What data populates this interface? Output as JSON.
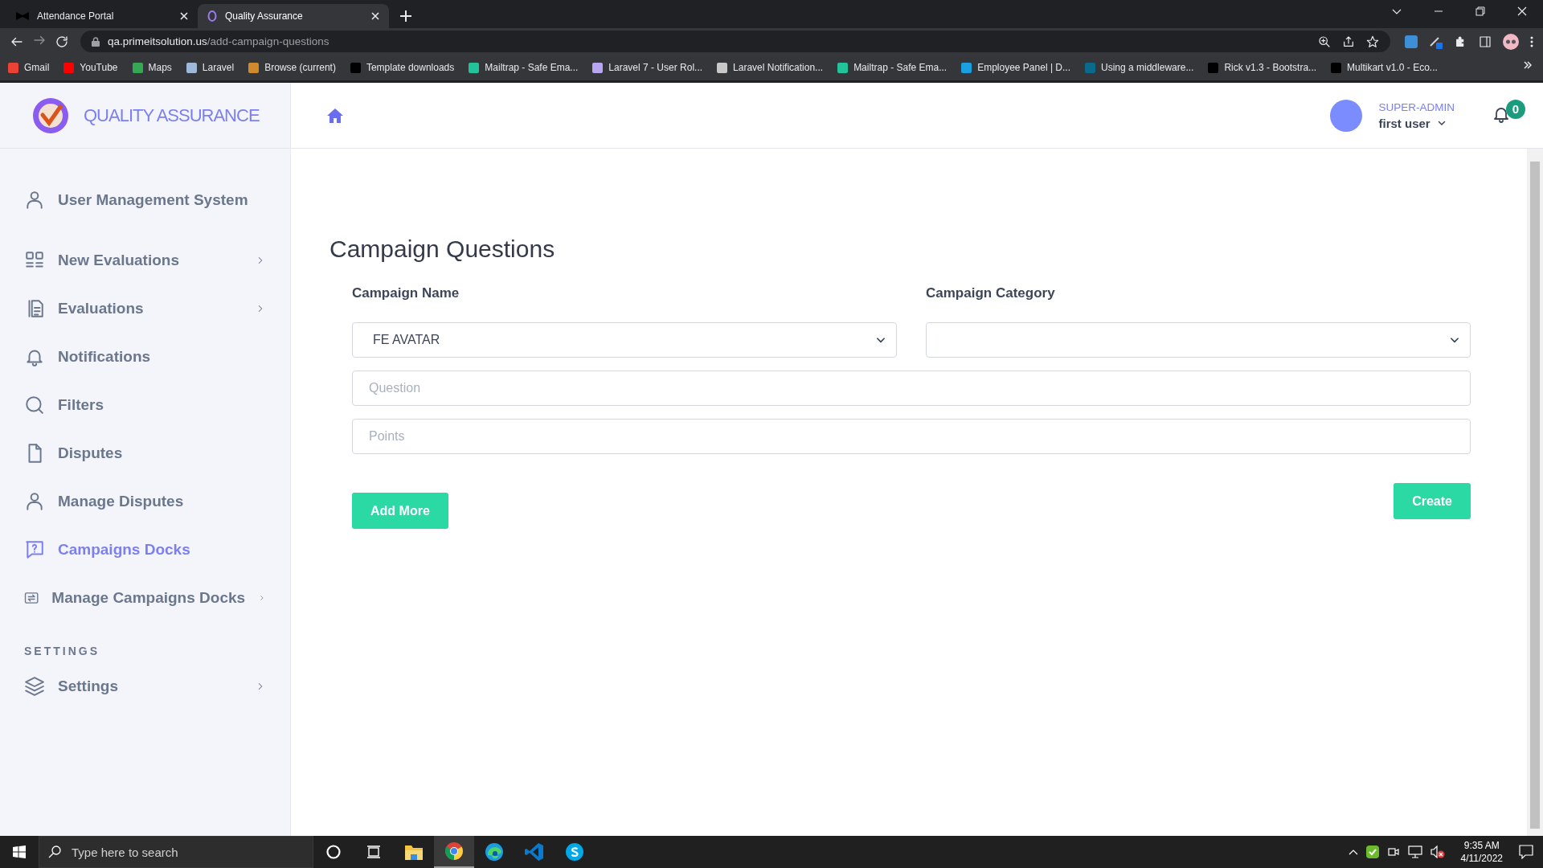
{
  "browser": {
    "tabs": [
      {
        "title": "Attendance Portal",
        "selected": false
      },
      {
        "title": "Quality Assurance",
        "selected": true
      }
    ],
    "address": {
      "host": "qa.primeitsolution.us",
      "path": "/add-campaign-questions"
    },
    "bookmarks": [
      {
        "label": "Gmail",
        "color": "#ea4335"
      },
      {
        "label": "YouTube",
        "color": "#ff0000"
      },
      {
        "label": "Maps",
        "color": "#34a853"
      },
      {
        "label": "Laravel",
        "color": "#9fb8d8"
      },
      {
        "label": "Browse (current)",
        "color": "#d08a2c"
      },
      {
        "label": "Template downloads",
        "color": "#000000"
      },
      {
        "label": "Mailtrap - Safe Ema...",
        "color": "#22c39a"
      },
      {
        "label": "Laravel 7 - User Rol...",
        "color": "#b9a6f0"
      },
      {
        "label": "Laravel Notification...",
        "color": "#c8c8c8"
      },
      {
        "label": "Mailtrap - Safe Ema...",
        "color": "#22c39a"
      },
      {
        "label": "Employee Panel | D...",
        "color": "#1a9fe0"
      },
      {
        "label": "Using a middleware...",
        "color": "#0a6a8c"
      },
      {
        "label": "Rick v1.3 - Bootstra...",
        "color": "#000000"
      },
      {
        "label": "Multikart v1.0 - Eco...",
        "color": "#000000"
      }
    ]
  },
  "app": {
    "brand": "QUALITY ASSURANCE",
    "sidebar": {
      "items": [
        {
          "label": "User Management System",
          "kind": "user",
          "expandable": false,
          "selected": false
        },
        {
          "label": "New Evaluations",
          "kind": "grid",
          "expandable": true,
          "selected": false
        },
        {
          "label": "Evaluations",
          "kind": "doc",
          "expandable": true,
          "selected": false
        },
        {
          "label": "Notifications",
          "kind": "bell",
          "expandable": false,
          "selected": false
        },
        {
          "label": "Filters",
          "kind": "search",
          "expandable": false,
          "selected": false
        },
        {
          "label": "Disputes",
          "kind": "file",
          "expandable": false,
          "selected": false
        },
        {
          "label": "Manage Disputes",
          "kind": "user",
          "expandable": false,
          "selected": false
        },
        {
          "label": "Campaigns Docks",
          "kind": "help",
          "expandable": false,
          "selected": true
        },
        {
          "label": "Manage Campaigns Docks",
          "kind": "swap",
          "expandable": true,
          "selected": false
        }
      ],
      "section_title": "SETTINGS",
      "section_items": [
        {
          "label": "Settings",
          "kind": "layers",
          "expandable": true,
          "selected": false
        }
      ]
    },
    "header": {
      "role": "SUPER-ADMIN",
      "user": "first user",
      "notification_count": "0"
    },
    "form": {
      "title": "Campaign Questions",
      "campaign_name_label": "Campaign Name",
      "campaign_name_value": "FE AVATAR",
      "campaign_category_label": "Campaign Category",
      "question": {
        "placeholder": "Question"
      },
      "points": {
        "placeholder": "Points"
      },
      "add_more": "Add More",
      "create": "Create"
    }
  },
  "taskbar": {
    "search": {
      "placeholder": "Type here to search"
    },
    "apps": [
      {
        "kind": "cortana",
        "selected": false
      },
      {
        "kind": "taskview",
        "selected": false
      },
      {
        "kind": "explorer",
        "selected": false
      },
      {
        "kind": "chrome",
        "selected": true
      },
      {
        "kind": "edge",
        "selected": false
      },
      {
        "kind": "vscode",
        "selected": false
      },
      {
        "kind": "skype",
        "selected": false
      }
    ],
    "time": "9:35 AM",
    "date": "4/11/2022"
  }
}
